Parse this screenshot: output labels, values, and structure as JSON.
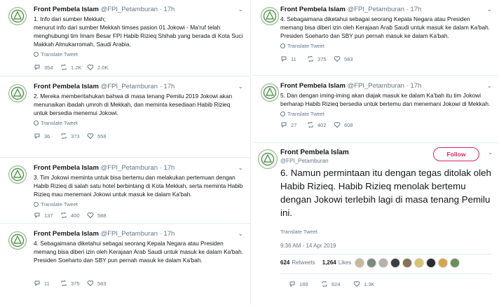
{
  "colors": {
    "accent": "#e0245e",
    "retweet": "#17bf63",
    "muted": "#657786",
    "avatar_green": "#4a8a45"
  },
  "left": [
    {
      "name": "Front Pembela Islam",
      "handle": "@FPI_Petamburan",
      "sep": "·",
      "time": "17h",
      "text": "1. Info dari sumber Mekkah;\nmenurut info dari sumber Mekkah timses pasion 01 Jokowi - Ma'ruf telah menghubungi tim Imam Besar FPI Habib Rizieq Shihab yang berada di Kota Suci Makkah Almukarromah, Saudi Arabia.",
      "translate": "Translate Tweet",
      "replies": "354",
      "retweets": "1.2K",
      "likes": "2.0K"
    },
    {
      "name": "Front Pembela Islam",
      "handle": "@FPI_Petamburan",
      "sep": "·",
      "time": "17h",
      "text": "2. Mereka memberitahukan bahwa di masa tenang Pemilu 2019 Jokowi akan menunaikan ibadah umroh di Mekkah, dan meminta kesediaan Habib Rizieq untuk bersedia menemui Jokowi.",
      "translate": "Translate Tweet",
      "replies": "36",
      "retweets": "373",
      "likes": "558"
    },
    {
      "name": "Front Pembela Islam",
      "handle": "@FPI_Petamburan",
      "sep": "·",
      "time": "17h",
      "text": "3. Tim Jokowi meminta untuk bisa bertemu dan melakukan pertemuan dengan Habib Rizieq di salah satu hotel berbintang di Kota Mekkah, serta meminta Habib Rizieq mau menemani Jokowi untuk masuk ke dalam Ka'bah.",
      "translate": "Translate Tweet",
      "replies": "137",
      "retweets": "400",
      "likes": "588"
    },
    {
      "name": "Front Pembela Islam",
      "handle": "@FPI_Petamburan",
      "sep": "·",
      "time": "17h",
      "text": "4. Sebagaimana diketahui sebagai seorang Kepala Negara atau Presiden memang bisa diberi izin oleh Kerajaan Arab Saudi untuk masuk ke dalam Ka'bah. Presiden Soeharto dan SBY pun pernah masuk ke dalam Ka'bah.",
      "translate": "",
      "replies": "11",
      "retweets": "375",
      "likes": "583"
    }
  ],
  "right": [
    {
      "name": "Front Pembela Islam",
      "handle": "@FPI_Petamburan",
      "sep": "·",
      "time": "17h",
      "text": "4. Sebagaimana diketahui sebagai seorang Kepala Negara atau Presiden memang bisa diberi izin oleh Kerajaan Arab Saudi untuk masuk ke dalam Ka'bah. Presiden Soeharto dan SBY pun pernah masuk ke dalam Ka'bah.",
      "translate": "Translate Tweet",
      "replies": "11",
      "retweets": "375",
      "likes": "583"
    },
    {
      "name": "Front Pembela Islam",
      "handle": "@FPI_Petamburan",
      "sep": "·",
      "time": "17h",
      "text": "5. Dan dengan iming-iming akan diajak masuk ke dalam Ka'bah itu tim Jokowi berharap Habib Rizieq bersedia untuk bertemu dan menemani Jokowi di Mekkah.",
      "translate": "Translate Tweet",
      "replies": "27",
      "retweets": "402",
      "likes": "608"
    }
  ],
  "big": {
    "name": "Front Pembela Islam",
    "handle": "@FPI_Petamburan",
    "follow": "Follow",
    "text": "6. Namun permintaan itu dengan tegas ditolak oleh Habib Rizieq. Habib Rizieq menolak bertemu dengan Jokowi terlebih lagi di masa tenang Pemilu ini.",
    "translate": "Translate Tweet",
    "timestamp": "9:36 AM - 14 Apr 2019",
    "retweet_count": "624",
    "retweet_label": "Retweets",
    "like_count": "1,264",
    "like_label": "Likes",
    "replies": "189",
    "retweets": "624",
    "likes": "1.3K"
  }
}
